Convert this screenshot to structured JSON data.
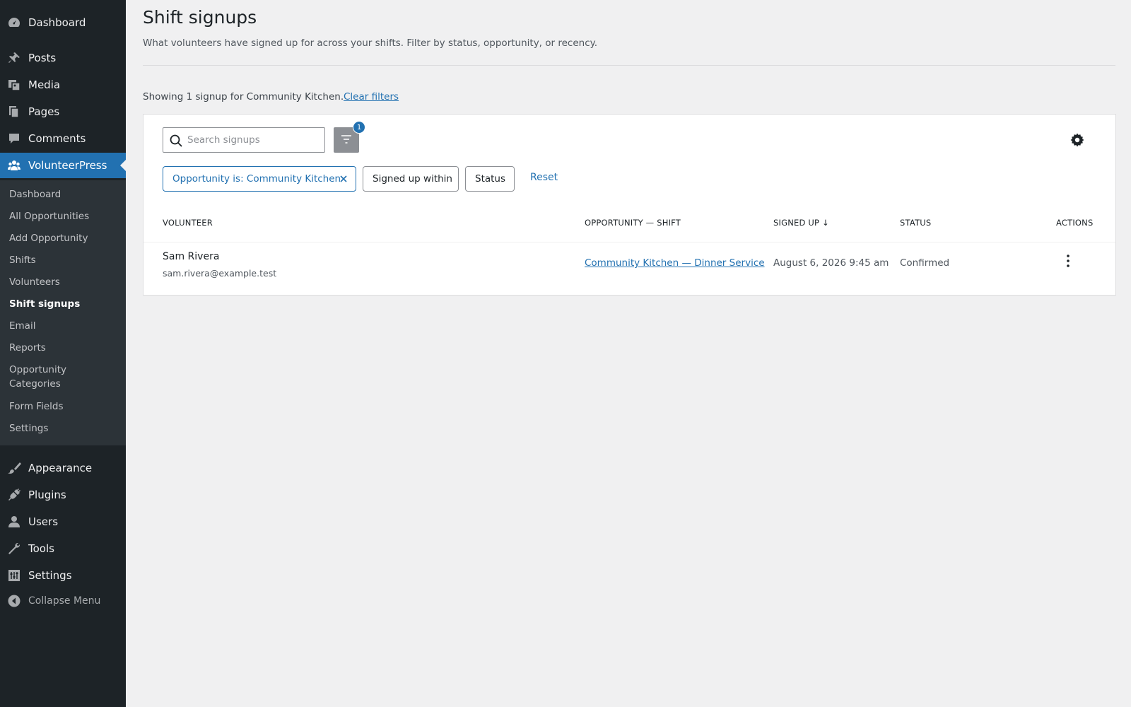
{
  "sidebar": {
    "top_items": [
      {
        "label": "Dashboard",
        "icon": "dashboard-icon"
      },
      {
        "label": "Posts",
        "icon": "pin-icon"
      },
      {
        "label": "Media",
        "icon": "media-icon"
      },
      {
        "label": "Pages",
        "icon": "pages-icon"
      },
      {
        "label": "Comments",
        "icon": "comment-icon"
      },
      {
        "label": "VolunteerPress",
        "icon": "people-icon"
      }
    ],
    "submenu": [
      "Dashboard",
      "All Opportunities",
      "Add Opportunity",
      "Shifts",
      "Volunteers",
      "Shift signups",
      "Email",
      "Reports",
      "Opportunity Categories",
      "Form Fields",
      "Settings"
    ],
    "bottom_items": [
      {
        "label": "Appearance",
        "icon": "brush-icon"
      },
      {
        "label": "Plugins",
        "icon": "plug-icon"
      },
      {
        "label": "Users",
        "icon": "user-icon"
      },
      {
        "label": "Tools",
        "icon": "wrench-icon"
      },
      {
        "label": "Settings",
        "icon": "settings-icon"
      }
    ],
    "collapse_label": "Collapse Menu",
    "accent_color": "#2271b1",
    "background_color": "#1d2327"
  },
  "page": {
    "title": "Shift signups",
    "description": "What volunteers have signed up for across your shifts. Filter by status, opportunity, or recency.",
    "showing_text": "Showing 1 signup for Community Kitchen.",
    "clear_filters": "Clear filters"
  },
  "toolbar": {
    "search_placeholder": "Search signups",
    "filter_count": "1",
    "chips": {
      "opportunity": "Opportunity is: Community Kitchen",
      "signed_up_within": "Signed up within",
      "status": "Status"
    },
    "reset_label": "Reset"
  },
  "table": {
    "headers": {
      "volunteer": "VOLUNTEER",
      "opportunity_shift": "OPPORTUNITY — SHIFT",
      "signed_up": "SIGNED UP ↓",
      "status": "STATUS",
      "actions": "ACTIONS"
    },
    "rows": [
      {
        "name": "Sam Rivera",
        "email": "sam.rivera@example.test",
        "opportunity_shift": "Community Kitchen — Dinner Service",
        "signed_up": "August 6, 2026 9:45 am",
        "status": "Confirmed"
      }
    ]
  }
}
